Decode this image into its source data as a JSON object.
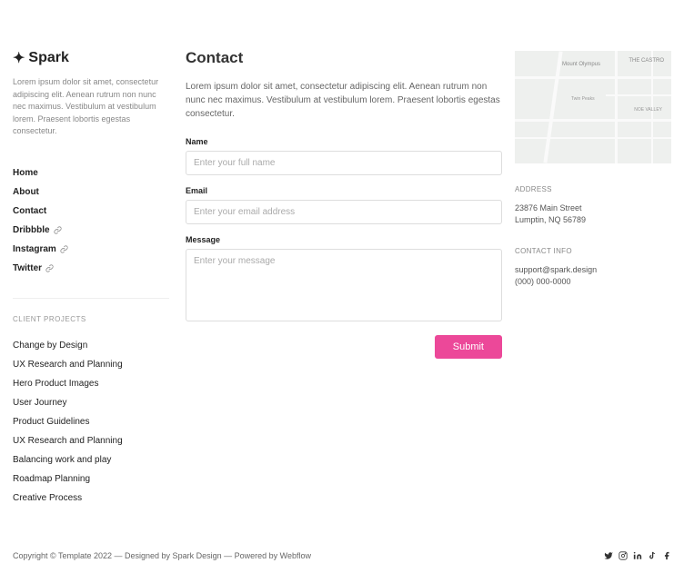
{
  "logo": {
    "text": "Spark"
  },
  "sidebar": {
    "description": "Lorem ipsum dolor sit amet, consectetur adipiscing elit. Aenean rutrum non nunc nec maximus. Vestibulum at vestibulum lorem. Praesent lobortis egestas consectetur.",
    "nav": [
      {
        "label": "Home",
        "external": false
      },
      {
        "label": "About",
        "external": false
      },
      {
        "label": "Contact",
        "external": false
      },
      {
        "label": "Dribbble",
        "external": true
      },
      {
        "label": "Instagram",
        "external": true
      },
      {
        "label": "Twitter",
        "external": true
      }
    ],
    "projects_label": "CLIENT PROJECTS",
    "projects": [
      "Change by Design",
      "UX Research and Planning",
      "Hero Product Images",
      "User Journey",
      "Product Guidelines",
      "UX Research and Planning",
      "Balancing work and play",
      "Roadmap Planning",
      "Creative Process"
    ]
  },
  "page": {
    "title": "Contact",
    "description": "Lorem ipsum dolor sit amet, consectetur adipiscing elit. Aenean rutrum non nunc nec maximus. Vestibulum at vestibulum lorem. Praesent lobortis egestas consectetur."
  },
  "form": {
    "name_label": "Name",
    "name_placeholder": "Enter your full name",
    "email_label": "Email",
    "email_placeholder": "Enter your email address",
    "message_label": "Message",
    "message_placeholder": "Enter your message",
    "submit_label": "Submit"
  },
  "aside": {
    "map": {
      "label_mt": "Mount Olympus",
      "label_castro": "THE CASTRO",
      "label_twin": "Twin Peaks",
      "label_noe": "NOE VALLEY"
    },
    "address_label": "ADDRESS",
    "address_line1": "23876 Main Street",
    "address_line2": "Lumptin, NQ 56789",
    "contact_label": "CONTACT INFO",
    "contact_email": "support@spark.design",
    "contact_phone": "(000) 000-0000"
  },
  "footer": {
    "text": "Copyright © Template 2022 — Designed by Spark Design — Powered by Webflow"
  }
}
